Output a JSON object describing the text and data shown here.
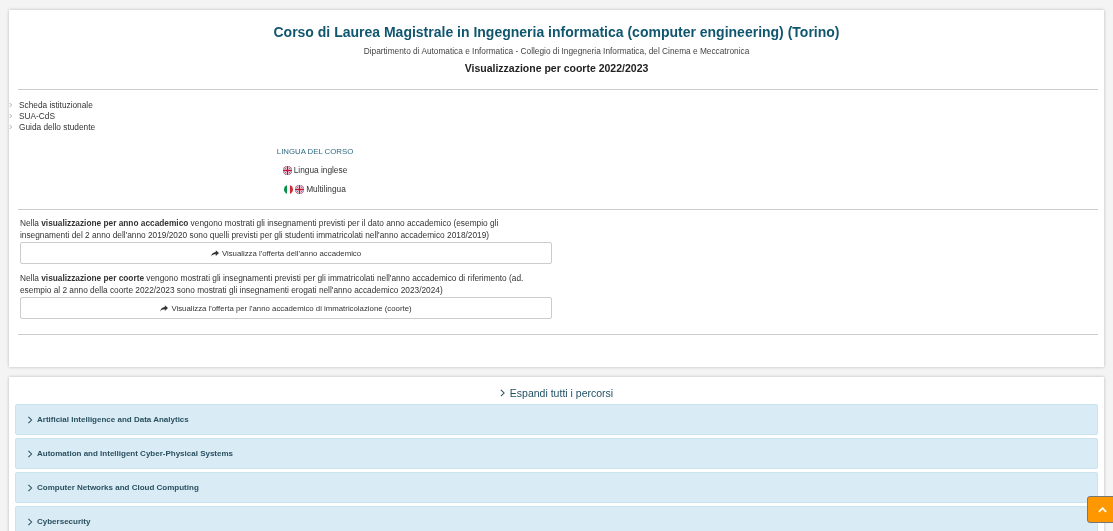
{
  "header": {
    "title": "Corso di Laurea Magistrale in Ingegneria informatica (computer engineering) (Torino)",
    "subtitle": "Dipartimento di Automatica e Informatica - Collegio di Ingegneria Informatica, del Cinema e Meccatronica",
    "view": "Visualizzazione per coorte 2022/2023"
  },
  "links": [
    "Scheda istituzionale",
    "SUA-CdS",
    "Guida dello studente"
  ],
  "language": {
    "heading": "LINGUA DEL CORSO",
    "items": [
      {
        "label": "Lingua inglese",
        "flags": [
          {
            "kind": "uk"
          }
        ]
      },
      {
        "label": "Multilingua",
        "flags": [
          {
            "kind": "it"
          },
          {
            "kind": "uk"
          }
        ]
      }
    ]
  },
  "views": [
    {
      "text": "Nella **visualizzazione per anno accademico** vengono mostrati gli insegnamenti previsti per il dato anno accademico (esempio gli insegnamenti del 2 anno dell'anno 2019/2020 sono quelli previsti per gli studenti immatricolati nell'anno accademico 2018/2019)",
      "button": "Visualizza l'offerta dell'anno accademico"
    },
    {
      "text": "Nella **visualizzazione per coorte** vengono mostrati gli insegnamenti previsti per gli immatricolati nell'anno accademico di riferimento (ad. esempio al 2 anno della coorte 2022/2023 sono mostrati gli insegnamenti erogati nell'anno accademico 2023/2024)",
      "button": "Visualizza l'offerta per l'anno accademico di immatricolazione (coorte)"
    }
  ],
  "expand_all": "Espandi tutti i percorsi",
  "tracks": [
    {
      "label": "Artificial Intelligence and Data Analytics",
      "expanded": false
    },
    {
      "label": "Automation and Intelligent Cyber-Physical Systems",
      "expanded": false
    },
    {
      "label": "Computer Networks and Cloud Computing",
      "expanded": false
    },
    {
      "label": "Cybersecurity",
      "expanded": false
    }
  ]
}
